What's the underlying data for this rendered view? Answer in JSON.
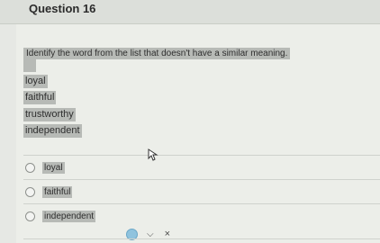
{
  "question": {
    "title": "Question 16",
    "prompt": "Identify the word from the list that doesn't have a similar meaning."
  },
  "word_list": [
    "loyal",
    "faithful",
    "trustworthy",
    "independent"
  ],
  "options": [
    {
      "label": "loyal",
      "selected": false
    },
    {
      "label": "faithful",
      "selected": false
    },
    {
      "label": "independent",
      "selected": false
    }
  ],
  "toolbar": {
    "icons": [
      "circle-icon",
      "chevron-down-icon",
      "close-icon"
    ],
    "chevron": "⌵",
    "close": "×"
  },
  "colors": {
    "highlight": "#b7bab6",
    "accent": "#8fc3de"
  }
}
